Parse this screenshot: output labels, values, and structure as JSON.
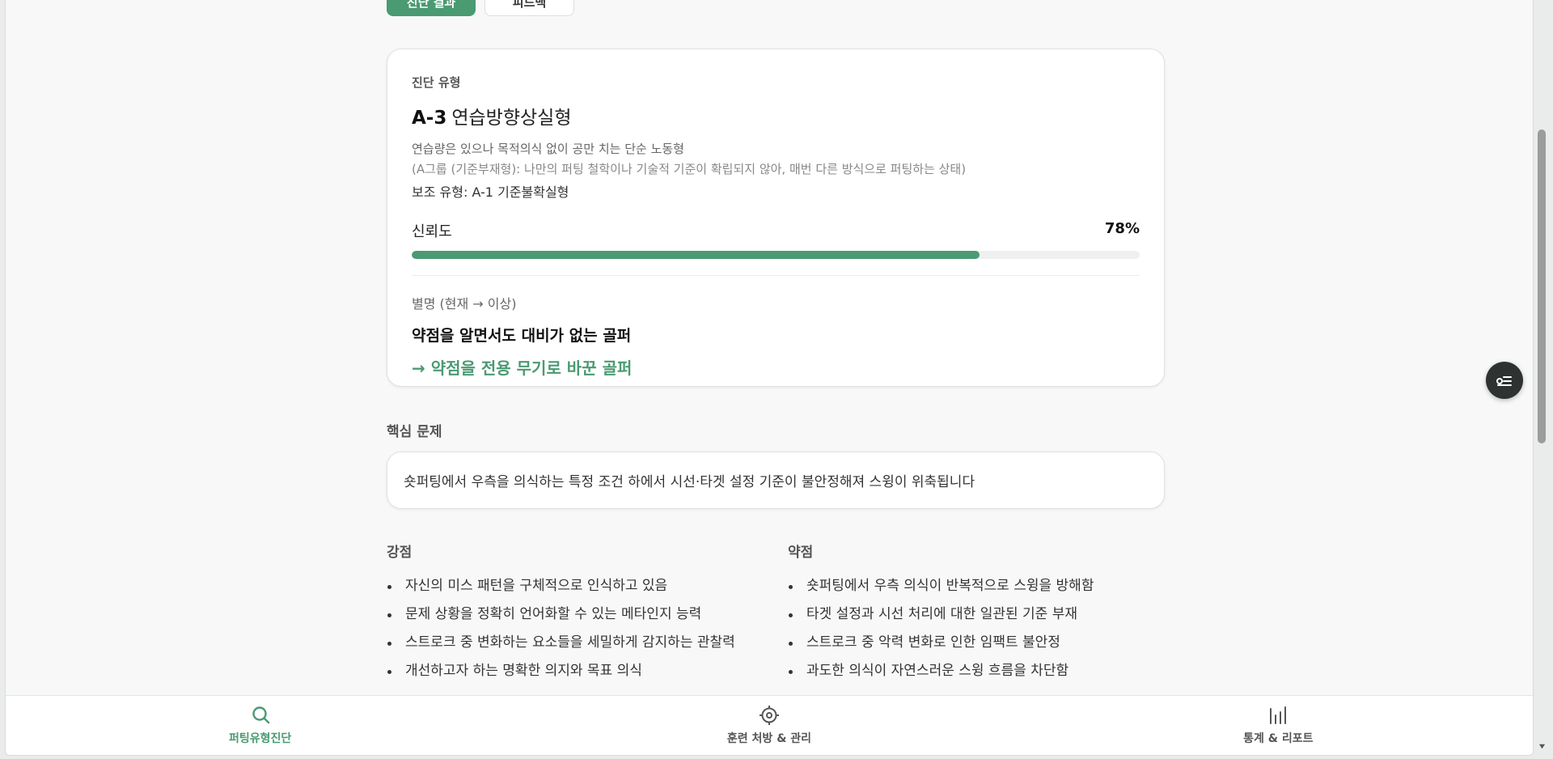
{
  "tabs": [
    {
      "label": "진단 결과"
    },
    {
      "label": "피드백"
    }
  ],
  "diagnosis": {
    "section_label": "진단 유형",
    "type_code": "A-3",
    "type_name": "연습방향상실형",
    "description": "연습량은 있으나 목적의식 없이 공만 치는 단순 노동형",
    "group_description": "(A그룹 (기준부재형): 나만의 퍼팅 철학이나 기술적 기준이 확립되지 않아, 매번 다른 방식으로 퍼팅하는 상태)",
    "sub_type": "보조 유형: A-1 기준불확실형",
    "confidence_label": "신뢰도",
    "confidence_value": "78%",
    "confidence_fraction": 0.78,
    "nickname_label": "별명 (현재 → 이상)",
    "nickname_current": "약점을 알면서도 대비가 없는 골퍼",
    "nickname_ideal": "→ 약점을 전용 무기로 바꾼 골퍼"
  },
  "core_problem": {
    "title": "핵심 문제",
    "text": "숏퍼팅에서 우측을 의식하는 특정 조건 하에서 시선·타겟 설정 기준이 불안정해져 스윙이 위축됩니다"
  },
  "strengths": {
    "title": "강점",
    "items": [
      "자신의 미스 패턴을 구체적으로 인식하고 있음",
      "문제 상황을 정확히 언어화할 수 있는 메타인지 능력",
      "스트로크 중 변화하는 요소들을 세밀하게 감지하는 관찰력",
      "개선하고자 하는 명확한 의지와 목표 의식"
    ]
  },
  "weaknesses": {
    "title": "약점",
    "items": [
      "숏퍼팅에서 우측 의식이 반복적으로 스윙을 방해함",
      "타겟 설정과 시선 처리에 대한 일관된 기준 부재",
      "스트로크 중 악력 변화로 인한 임팩트 불안정",
      "과도한 의식이 자연스러운 스윙 흐름을 차단함"
    ]
  },
  "bottom_nav": [
    {
      "label": "퍼팅유형진단",
      "icon": "search-icon",
      "active": true
    },
    {
      "label": "훈련 처방 & 관리",
      "icon": "target-icon",
      "active": false
    },
    {
      "label": "통계 & 리포트",
      "icon": "bar-chart-icon",
      "active": false
    }
  ],
  "colors": {
    "accent": "#4a9a72",
    "fab": "#2e3230"
  }
}
